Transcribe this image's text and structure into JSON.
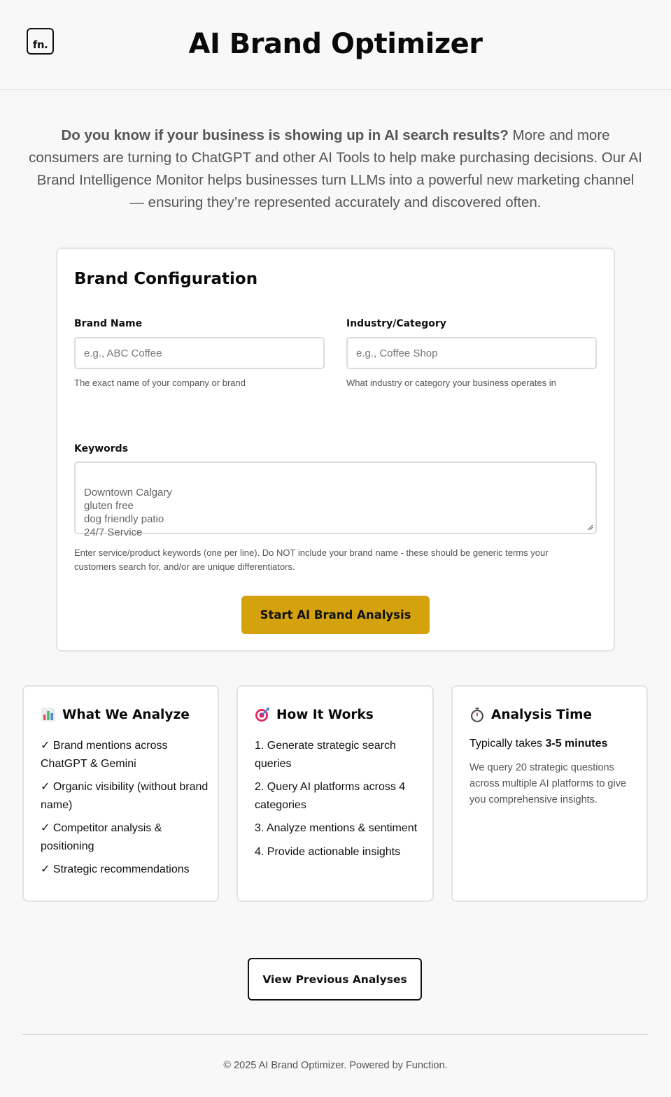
{
  "header": {
    "logo_text": "fn.",
    "title": "AI Brand Optimizer"
  },
  "intro": {
    "bold": "Do you know if your business is showing up in AI search results?",
    "text": " More and more consumers are turning to ChatGPT and other AI Tools to help make purchasing decisions. Our AI Brand Intelligence Monitor helps businesses turn LLMs into a powerful new marketing channel — ensuring they’re represented accurately and discovered often."
  },
  "config": {
    "title": "Brand Configuration",
    "brand_name": {
      "label": "Brand Name",
      "placeholder": "e.g., ABC Coffee",
      "help": "The exact name of your company or brand"
    },
    "industry": {
      "label": "Industry/Category",
      "placeholder": "e.g., Coffee Shop",
      "help": "What industry or category your business operates in"
    },
    "keywords": {
      "label": "Keywords",
      "value": "Downtown Calgary\ngluten free\ndog friendly patio\n24/7 Service",
      "help": "Enter service/product keywords (one per line). Do NOT include your brand name - these should be generic terms your customers search for, and/or are unique differentiators."
    },
    "start_button": "Start AI Brand Analysis",
    "accent_color": "#d4a20d"
  },
  "cards": {
    "analyze": {
      "icon": "bar-chart-icon",
      "title": "What We Analyze",
      "items": [
        "✓ Brand mentions across ChatGPT & Gemini",
        "✓ Organic visibility (without brand name)",
        "✓ Competitor analysis & positioning",
        "✓ Strategic recommendations"
      ]
    },
    "how": {
      "icon": "target-icon",
      "title": "How It Works",
      "items": [
        "1. Generate strategic search queries",
        "2. Query AI platforms across 4 categories",
        "3. Analyze mentions & sentiment",
        "4. Provide actionable insights"
      ]
    },
    "time": {
      "icon": "stopwatch-icon",
      "title": "Analysis Time",
      "prefix": "Typically takes ",
      "duration": "3-5 minutes",
      "description": "We query 20 strategic questions across multiple AI platforms to give you comprehensive insights."
    }
  },
  "previous_button": "View Previous Analyses",
  "footer": "© 2025 AI Brand Optimizer. Powered by Function."
}
